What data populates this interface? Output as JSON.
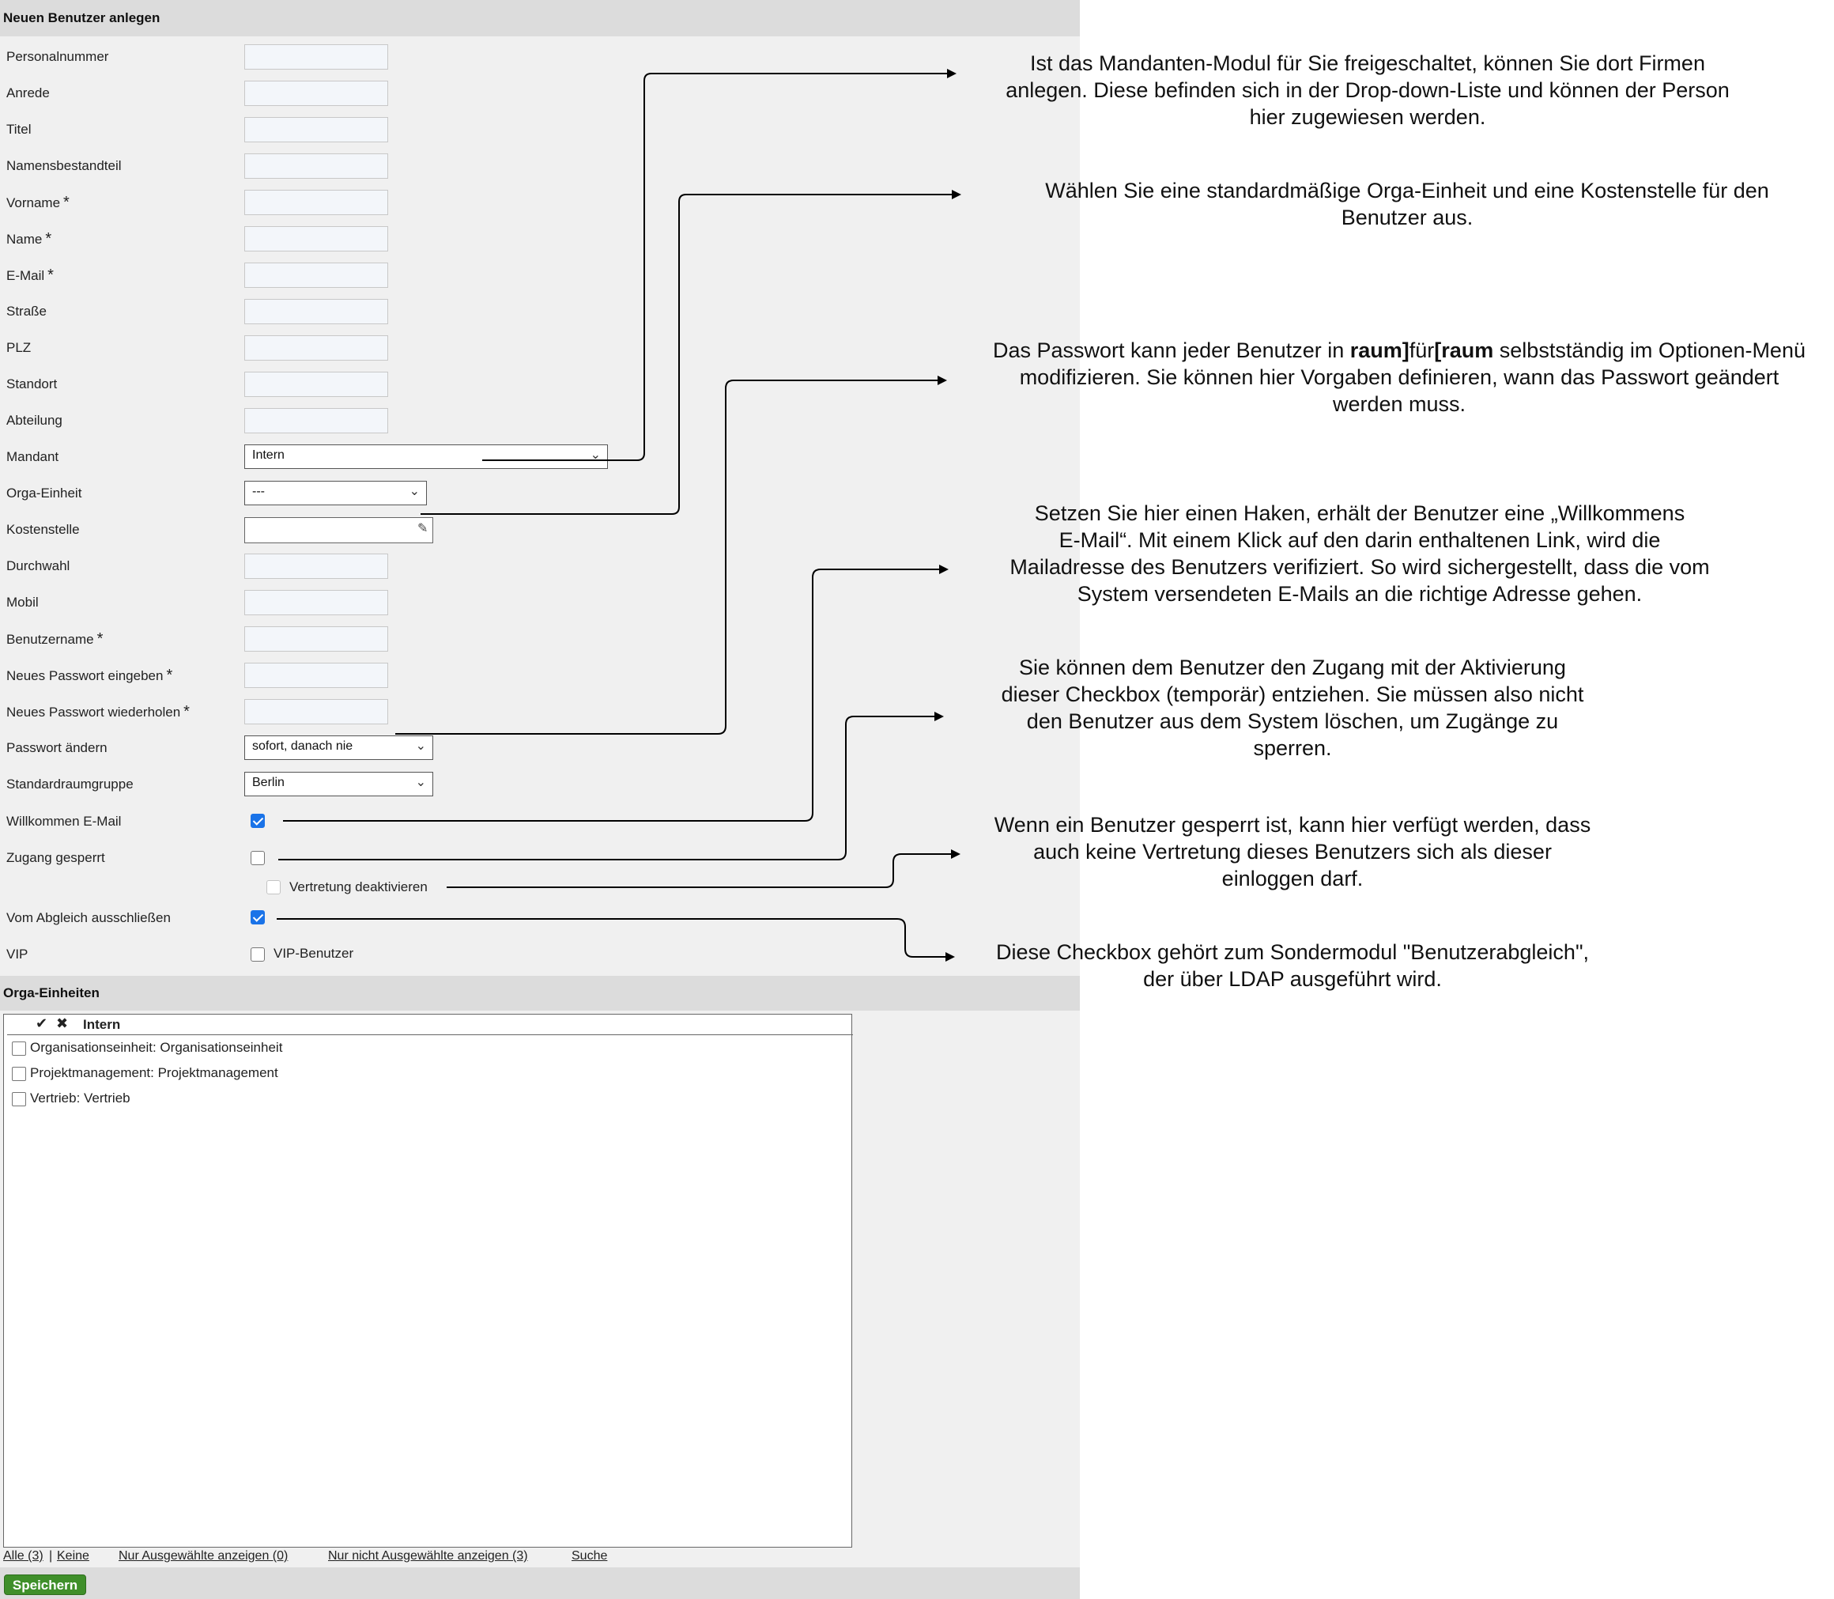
{
  "form": {
    "title": "Neuen Benutzer anlegen",
    "fields": {
      "personalnummer": "Personalnummer",
      "anrede": "Anrede",
      "titel": "Titel",
      "namensbestandteil": "Namensbestandteil",
      "vorname": "Vorname",
      "name": "Name",
      "email": "E-Mail",
      "strasse": "Straße",
      "plz": "PLZ",
      "standort": "Standort",
      "abteilung": "Abteilung",
      "mandant": "Mandant",
      "orga_einheit": "Orga-Einheit",
      "kostenstelle": "Kostenstelle",
      "durchwahl": "Durchwahl",
      "mobil": "Mobil",
      "benutzername": "Benutzername",
      "neues_passwort": "Neues Passwort eingeben",
      "passwort_wiederholen": "Neues Passwort wiederholen",
      "passwort_aendern": "Passwort ändern",
      "standardraumgruppe": "Standardraumgruppe",
      "willkommen_email": "Willkommen E-Mail",
      "zugang_gesperrt": "Zugang gesperrt",
      "vertretung_deaktivieren": "Vertretung deaktivieren",
      "vom_abgleich": "Vom Abgleich ausschließen",
      "vip": "VIP",
      "vip_benutzer": "VIP-Benutzer"
    },
    "required_marker": "*",
    "values": {
      "mandant": "Intern",
      "orga_einheit": "---",
      "passwort_aendern": "sofort, danach nie",
      "standardraumgruppe": "Berlin"
    },
    "checkboxes": {
      "willkommen_email": true,
      "zugang_gesperrt": false,
      "vertretung_deaktivieren": false,
      "vom_abgleich": true,
      "vip": false
    }
  },
  "orga": {
    "title": "Orga-Einheiten",
    "header_check_icon": "✔",
    "header_cross_icon": "✖",
    "header_label": "Intern",
    "items": [
      "Organisationseinheit: Organisationseinheit",
      "Projektmanagement: Projektmanagement",
      "Vertrieb: Vertrieb"
    ]
  },
  "footer": {
    "alle": "Alle (3)",
    "separator": "|",
    "keine": "Keine",
    "nur_ausgewaehlte": "Nur Ausgewählte anzeigen (0)",
    "nur_nicht_ausgewaehlte": "Nur nicht Ausgewählte anzeigen (3)",
    "suche": "Suche",
    "save": "Speichern"
  },
  "annotations": {
    "mandant_note": [
      "Ist das Mandanten-Modul für Sie freigeschaltet, können Sie dort Firmen",
      "anlegen. Diese befinden sich in der Drop-down-Liste und können der Person",
      "hier zugewiesen werden."
    ],
    "orga_note": [
      "Wählen Sie eine standardmäßige Orga-Einheit und eine Kostenstelle für den",
      "Benutzer aus."
    ],
    "password_note": {
      "line1_before": "Das Passwort kann jeder Benutzer in ",
      "line1_bold1": "raum]",
      "line1_mid": "für",
      "line1_bold2": "[raum",
      "line1_after": " selbstständig im Optionen-Menü",
      "line2": "modifizieren. Sie können hier Vorgaben definieren, wann das Passwort geändert",
      "line3": "werden muss."
    },
    "welcome_note": [
      "Setzen Sie hier einen Haken, erhält der Benutzer eine „Willkommens",
      "E-Mail“. Mit einem Klick auf den darin enthaltenen Link, wird die",
      "Mailadresse des Benutzers verifiziert. So wird sichergestellt, dass die vom",
      "System versendeten E-Mails an die richtige Adresse gehen."
    ],
    "lock_note": [
      "Sie können dem Benutzer den Zugang mit der Aktivierung",
      "dieser Checkbox (temporär) entziehen. Sie müssen also nicht",
      "den Benutzer aus dem System löschen, um Zugänge zu",
      "sperren."
    ],
    "deputy_note": [
      "Wenn ein Benutzer gesperrt ist, kann hier verfügt werden, dass",
      "auch keine Vertretung dieses Benutzers sich als dieser",
      "einloggen darf."
    ],
    "ldap_note": [
      "Diese Checkbox gehört zum Sondermodul \"Benutzerabgleich\",",
      "der über LDAP ausgeführt wird."
    ]
  },
  "icons": {
    "dropdown": "chevron-down-icon",
    "picker": "edit-picker-icon"
  }
}
